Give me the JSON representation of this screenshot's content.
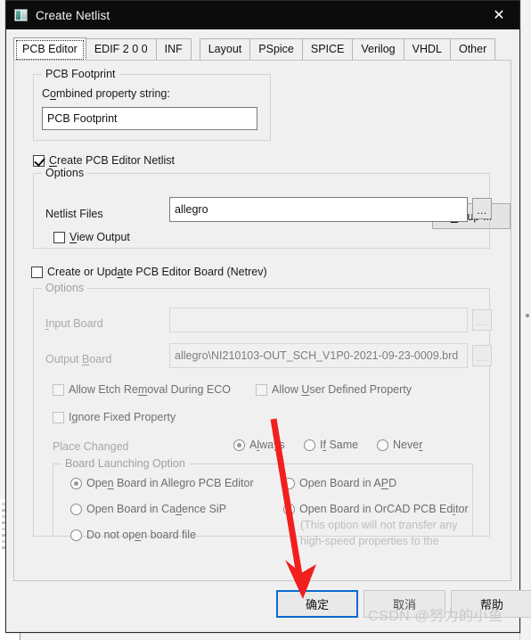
{
  "window": {
    "title": "Create Netlist",
    "icon": "app-window-icon",
    "close_label": "✕",
    "accent_focus_color": "#0a6bd0",
    "titlebar_color": "#0c0c0c"
  },
  "tabs": [
    {
      "label": "PCB Editor",
      "active": true
    },
    {
      "label": "EDIF 2 0 0",
      "active": false
    },
    {
      "label": "INF",
      "active": false
    },
    {
      "label": "Layout",
      "active": false
    },
    {
      "label": "PSpice",
      "active": false
    },
    {
      "label": "SPICE",
      "active": false
    },
    {
      "label": "Verilog",
      "active": false
    },
    {
      "label": "VHDL",
      "active": false
    },
    {
      "label": "Other",
      "active": false
    }
  ],
  "pcb_footprint_group": {
    "legend": "PCB Footprint",
    "combined_property_label": "Combined property string:",
    "combined_property_value": "PCB Footprint"
  },
  "create_netlist_checkbox": {
    "label": "Create PCB Editor Netlist",
    "checked": true
  },
  "setup_button": {
    "label": "Setup ..."
  },
  "netlist_options_group": {
    "legend": "Options",
    "netlist_files_label": "Netlist Files",
    "netlist_files_value": "allegro",
    "browse_label": "...",
    "view_output_label": "View Output",
    "view_output_checked": false
  },
  "netrev_checkbox": {
    "label": "Create or Update PCB Editor Board (Netrev)",
    "checked": false
  },
  "netrev_options_group": {
    "legend": "Options",
    "input_board_label": "Input Board",
    "input_board_value": "",
    "output_board_label": "Output Board",
    "output_board_value": "allegro\\NI210103-OUT_SCH_V1P0-2021-09-23-0009.brd",
    "browse_label": "...",
    "checkboxes": [
      {
        "label": "Allow Etch Removal During ECO",
        "checked": false
      },
      {
        "label": "Allow User Defined Property",
        "checked": false
      },
      {
        "label": "Ignore Fixed Property",
        "checked": false
      }
    ],
    "place_changed_label": "Place Changed",
    "place_changed_options": [
      {
        "label": "Always",
        "selected": true
      },
      {
        "label": "If Same",
        "selected": false
      },
      {
        "label": "Never",
        "selected": false
      }
    ],
    "board_launching_group": {
      "legend": "Board Launching Option",
      "options_left": [
        {
          "label": "Open Board in Allegro PCB Editor",
          "selected": true
        },
        {
          "label": "Open Board in Cadence SiP",
          "selected": false
        },
        {
          "label": "Do not open board file",
          "selected": false
        }
      ],
      "options_right": [
        {
          "label": "Open Board in APD",
          "selected": false
        },
        {
          "label": "Open Board in OrCAD PCB Editor",
          "selected": false
        }
      ],
      "note_line1": "(This option will not transfer any",
      "note_line2": "high-speed properties to the"
    }
  },
  "footer_buttons": {
    "ok_label": "确定",
    "cancel_label": "取消",
    "help_label": "帮助"
  },
  "watermark": {
    "text": "CSDN @努力的小鱼"
  },
  "annotation": {
    "arrow_color": "#f21f1f",
    "description": "red-arrow-pointing-to-ok-button"
  }
}
